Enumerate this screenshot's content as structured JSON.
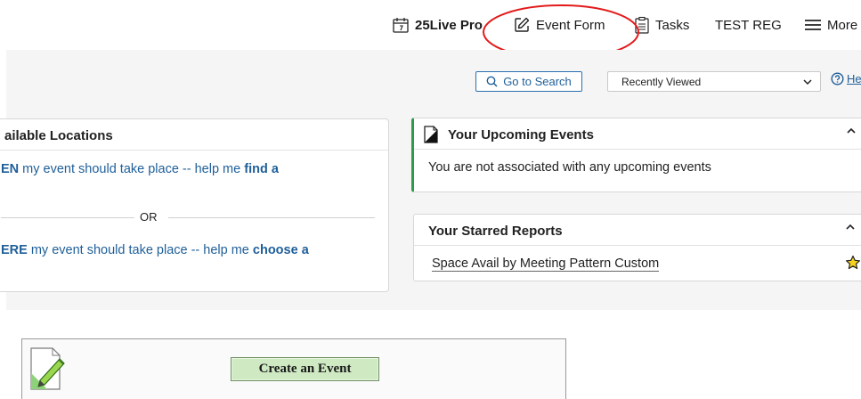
{
  "nav": {
    "pro_label": "25Live Pro",
    "event_form_label": "Event Form",
    "tasks_label": "Tasks",
    "user_label": "TEST REG",
    "more_label": "More"
  },
  "toolbar": {
    "search_label": "Go to Search",
    "recent_label": "Recently Viewed",
    "help_label": "He"
  },
  "locations_card": {
    "title": "ailable Locations",
    "when_prefix": "EN",
    "when_text": " my event should take place -- help me ",
    "when_action": "find a",
    "or_label": "OR",
    "where_prefix": "ERE",
    "where_text": " my event should take place -- help me ",
    "where_action": "choose a"
  },
  "upcoming_card": {
    "title": "Your Upcoming Events",
    "body": "You are not associated with any upcoming events"
  },
  "starred_card": {
    "title": "Your Starred Reports",
    "report_label": "Space Avail by Meeting Pattern Custom"
  },
  "create": {
    "button_label": "Create an Event"
  },
  "colors": {
    "link": "#1f5f99",
    "accent_green": "#2e9b4a",
    "annotation_red": "#e21b1b"
  }
}
